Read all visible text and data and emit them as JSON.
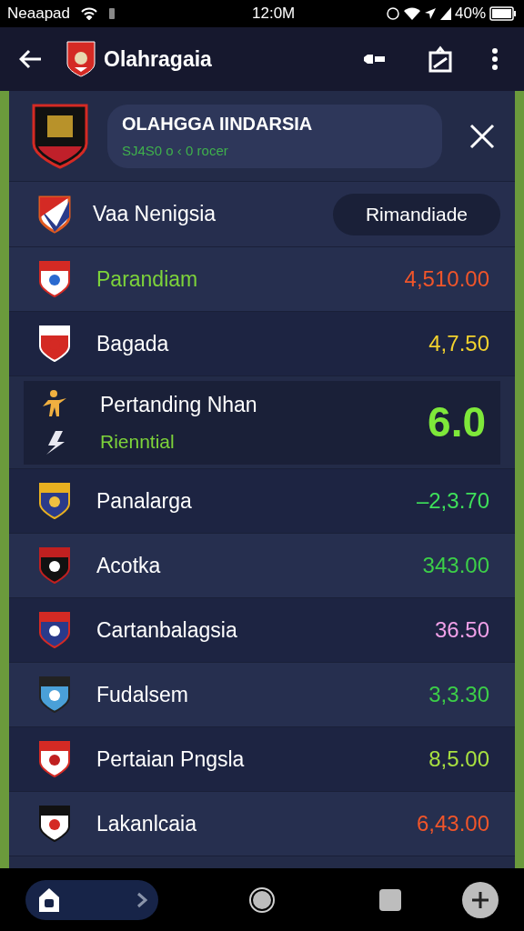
{
  "status_bar": {
    "carrier": "Neaapad",
    "time": "12:0M",
    "battery": "40%"
  },
  "app_bar": {
    "title": "Olahragaia"
  },
  "header_card": {
    "title": "OLAHGGA IINDARSIA",
    "subtitle": "SJ4S0 o ‹ 0 rocer"
  },
  "filter_row": {
    "label": "Vaa Nenigsia",
    "button": "Rimandiade"
  },
  "rows": [
    {
      "kind": "plain",
      "name": "Parandiam",
      "accented": true,
      "value": "4,510.00",
      "color": "#f0552a"
    },
    {
      "kind": "plain",
      "name": "Bagada",
      "accented": false,
      "value": "4,7.50",
      "color": "#f2d22e"
    },
    {
      "kind": "featured",
      "name": "Pertanding Nhan",
      "subtitle": "Rienntial",
      "accented": false,
      "value": "6.0",
      "color": "#7ee83a"
    },
    {
      "kind": "plain",
      "name": "Panalarga",
      "accented": false,
      "value": "–2,3.70",
      "color": "#3ee05a"
    },
    {
      "kind": "plain",
      "name": "Acotka",
      "accented": false,
      "value": "343.00",
      "color": "#3ccf48"
    },
    {
      "kind": "plain",
      "name": "Cartanbalagsia",
      "accented": false,
      "value": "36.50",
      "color": "#f0a0e8"
    },
    {
      "kind": "plain",
      "name": "Fudalsem",
      "accented": false,
      "value": "3,3.30",
      "color": "#3ccf48"
    },
    {
      "kind": "plain",
      "name": "Pertaian Pngsla",
      "accented": false,
      "value": "8,5.00",
      "color": "#a8e040"
    },
    {
      "kind": "plain",
      "name": "Lakanlcaia",
      "accented": false,
      "value": "6,43.00",
      "color": "#f0552a"
    }
  ]
}
